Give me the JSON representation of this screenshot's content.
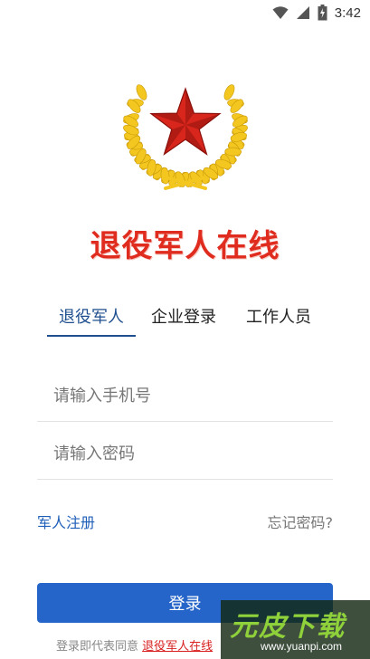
{
  "status_bar": {
    "time": "3:42",
    "icons": [
      "wifi-icon",
      "signal-icon",
      "battery-icon"
    ]
  },
  "header": {
    "emblem": "red-star-wreath-emblem",
    "title": "退役军人在线"
  },
  "tabs": [
    {
      "label": "退役军人",
      "active": true
    },
    {
      "label": "企业登录",
      "active": false
    },
    {
      "label": "工作人员",
      "active": false
    }
  ],
  "form": {
    "phone_placeholder": "请输入手机号",
    "password_placeholder": "请输入密码",
    "register_link": "军人注册",
    "forgot_link": "忘记密码?",
    "login_button": "登录"
  },
  "agreement": {
    "prefix": "登录即代表同意",
    "link": "退役军人在线"
  },
  "watermark": {
    "text": "元皮下载",
    "url": "www.yuanpi.com"
  },
  "colors": {
    "accent_blue": "#2565c9",
    "title_red": "#e02b1f",
    "tab_active": "#1f4f8f",
    "star_red": "#d9261c",
    "wreath_gold": "#f3c71f"
  }
}
